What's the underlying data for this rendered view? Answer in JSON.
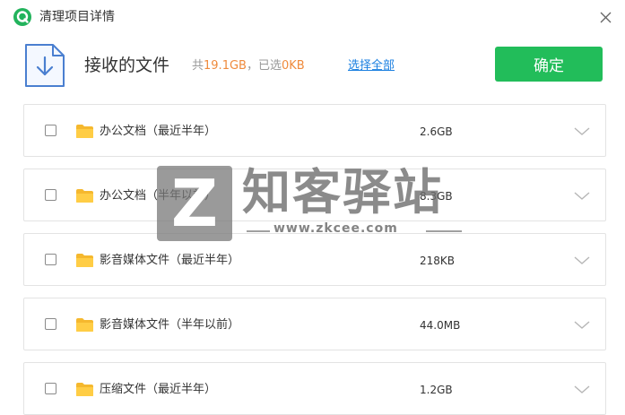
{
  "window": {
    "title": "清理项目详情",
    "logo_icon": "app-logo-icon",
    "close_icon": "close-icon"
  },
  "header": {
    "title": "接收的文件",
    "summary_prefix": "共",
    "total_size": "19.1GB",
    "summary_mid": "，已选",
    "selected_size": "0KB",
    "select_all_label": "选择全部",
    "confirm_label": "确定",
    "accent_color": "#22bd5a"
  },
  "items": [
    {
      "name": "办公文档（最近半年）",
      "size": "2.6GB",
      "checked": false
    },
    {
      "name": "办公文档（半年以前）",
      "size": "8.3GB",
      "checked": false
    },
    {
      "name": "影音媒体文件（最近半年）",
      "size": "218KB",
      "checked": false
    },
    {
      "name": "影音媒体文件（半年以前）",
      "size": "44.0MB",
      "checked": false
    },
    {
      "name": "压缩文件（最近半年）",
      "size": "1.2GB",
      "checked": false
    }
  ],
  "watermark": {
    "letter": "Z",
    "text": "知客驿站",
    "url": "www.zkcee.com"
  }
}
